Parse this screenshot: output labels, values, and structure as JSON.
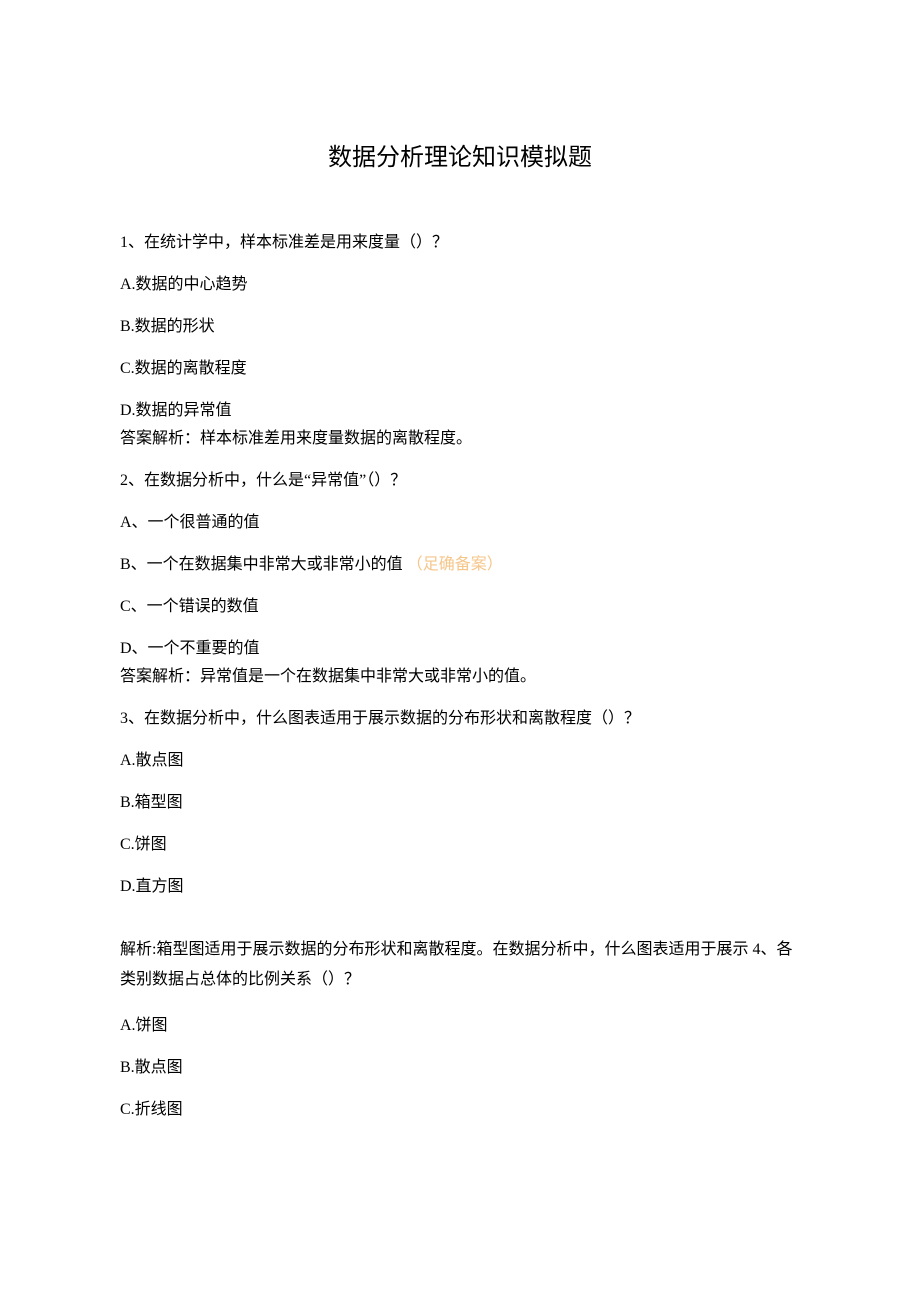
{
  "title": "数据分析理论知识模拟题",
  "q1": {
    "stem": "1、在统计学中，样本标准差是用来度量（）？",
    "A": "A.数据的中心趋势",
    "B": "B.数据的形状",
    "C": "C.数据的离散程度",
    "D": "D.数据的异常值",
    "ans": "答案解析：样本标准差用来度量数据的离散程度。"
  },
  "q2": {
    "stem": "2、在数据分析中，什么是“异常值”（）？",
    "A": "A、一个很普通的值",
    "B": "B、一个在数据集中非常大或非常小的值",
    "Bmark": "（足确备案）",
    "C": "C、一个错误的数值",
    "D": "D、一个不重要的值",
    "ans": "答案解析：异常值是一个在数据集中非常大或非常小的值。"
  },
  "q3": {
    "stem": "3、在数据分析中，什么图表适用于展示数据的分布形状和离散程度（）？",
    "A": "A.散点图",
    "B": "B.箱型图",
    "C": "C.饼图",
    "D": "D.直方图"
  },
  "merge34": "解析:箱型图适用于展示数据的分布形状和离散程度。在数据分析中，什么图表适用于展示 4、各类别数据占总体的比例关系（）？",
  "q4": {
    "A": "A.饼图",
    "B": "B.散点图",
    "C": "C.折线图"
  }
}
